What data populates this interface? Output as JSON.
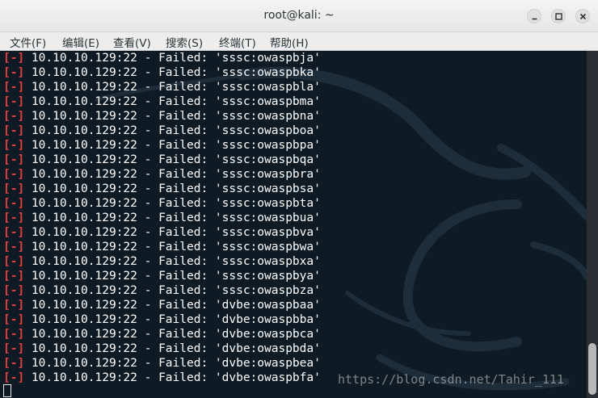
{
  "window": {
    "title": "root@kali: ~",
    "controls": [
      "minimize",
      "maximize",
      "close"
    ]
  },
  "menu": [
    "文件(F)",
    "编辑(E)",
    "查看(V)",
    "搜索(S)",
    "终端(T)",
    "帮助(H)"
  ],
  "terminal": {
    "prefix": "[-]",
    "lines": [
      " 10.10.10.129:22 - Failed: 'sssc:owaspbja'",
      " 10.10.10.129:22 - Failed: 'sssc:owaspbka'",
      " 10.10.10.129:22 - Failed: 'sssc:owaspbla'",
      " 10.10.10.129:22 - Failed: 'sssc:owaspbma'",
      " 10.10.10.129:22 - Failed: 'sssc:owaspbna'",
      " 10.10.10.129:22 - Failed: 'sssc:owaspboa'",
      " 10.10.10.129:22 - Failed: 'sssc:owaspbpa'",
      " 10.10.10.129:22 - Failed: 'sssc:owaspbqa'",
      " 10.10.10.129:22 - Failed: 'sssc:owaspbra'",
      " 10.10.10.129:22 - Failed: 'sssc:owaspbsa'",
      " 10.10.10.129:22 - Failed: 'sssc:owaspbta'",
      " 10.10.10.129:22 - Failed: 'sssc:owaspbua'",
      " 10.10.10.129:22 - Failed: 'sssc:owaspbva'",
      " 10.10.10.129:22 - Failed: 'sssc:owaspbwa'",
      " 10.10.10.129:22 - Failed: 'sssc:owaspbxa'",
      " 10.10.10.129:22 - Failed: 'sssc:owaspbya'",
      " 10.10.10.129:22 - Failed: 'sssc:owaspbza'",
      " 10.10.10.129:22 - Failed: 'dvbe:owaspbaa'",
      " 10.10.10.129:22 - Failed: 'dvbe:owaspbba'",
      " 10.10.10.129:22 - Failed: 'dvbe:owaspbca'",
      " 10.10.10.129:22 - Failed: 'dvbe:owaspbda'",
      " 10.10.10.129:22 - Failed: 'dvbe:owaspbea'",
      " 10.10.10.129:22 - Failed: 'dvbe:owaspbfa'"
    ]
  },
  "watermark": "https://blog.csdn.net/Tahir_111",
  "colors": {
    "terminal_bg": "#0f1b24",
    "error_bracket": "#e33d3d",
    "text": "#ffffff"
  }
}
